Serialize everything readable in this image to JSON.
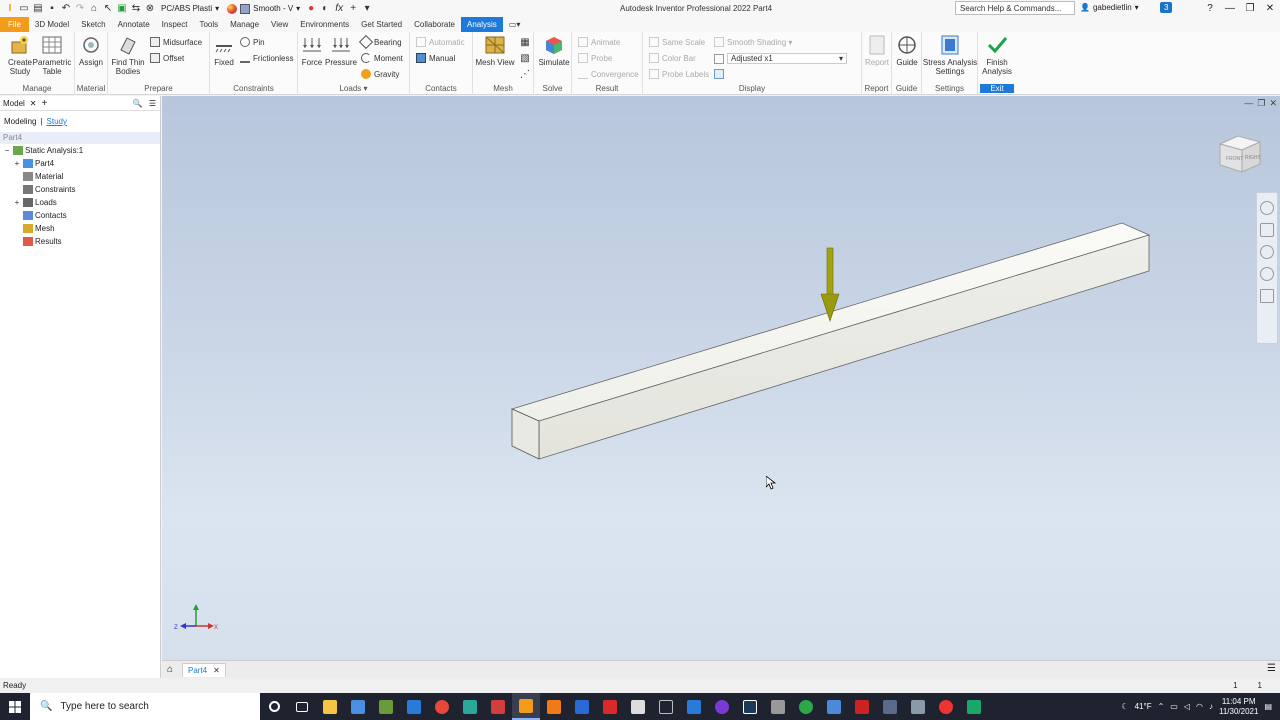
{
  "titlebar": {
    "app_title": "Autodesk Inventor Professional 2022   Part4",
    "material": "PC/ABS Plasti",
    "appearance": "Smooth - V",
    "fx": "fx",
    "search_placeholder": "Search Help & Commands...",
    "user": "gabedietlin",
    "notifications": "3"
  },
  "menu": {
    "tabs": [
      "File",
      "3D Model",
      "Sketch",
      "Annotate",
      "Inspect",
      "Tools",
      "Manage",
      "View",
      "Environments",
      "Get Started",
      "Collaborate",
      "Analysis"
    ],
    "active": "Analysis"
  },
  "ribbon": {
    "panels": {
      "manage": "Manage",
      "material": "Material",
      "prepare": "Prepare",
      "constraints": "Constraints",
      "loads": "Loads ▾",
      "contacts": "Contacts",
      "mesh": "Mesh",
      "solve": "Solve",
      "result": "Result",
      "display": "Display",
      "report": "Report",
      "guide": "Guide",
      "settings": "Settings",
      "exit": "Exit"
    },
    "buttons": {
      "create_study": "Create Study",
      "parametric_table": "Parametric Table",
      "assign": "Assign",
      "find_thin_bodies": "Find Thin Bodies",
      "midsurface": "Midsurface",
      "offset": "Offset",
      "fixed": "Fixed",
      "pin": "Pin",
      "frictionless": "Frictionless",
      "force": "Force",
      "pressure": "Pressure",
      "bearing": "Bearing",
      "moment": "Moment",
      "gravity": "Gravity",
      "automatic": "Automatic",
      "manual": "Manual",
      "mesh_view": "Mesh View",
      "simulate": "Simulate",
      "animate": "Animate",
      "probe": "Probe",
      "convergence": "Convergence",
      "same_scale": "Same Scale",
      "color_bar": "Color Bar",
      "probe_labels": "Probe Labels",
      "smooth_shading": "Smooth Shading ▾",
      "adjusted": "Adjusted x1",
      "report": "Report",
      "guide": "Guide",
      "stress_settings": "Stress Analysis Settings",
      "finish_analysis": "Finish Analysis"
    }
  },
  "browser": {
    "tab": "Model",
    "modes": {
      "modeling": "Modeling",
      "study": "Study"
    },
    "root": "Part4",
    "tree": [
      {
        "label": "Static Analysis:1",
        "level": 0,
        "expand": "−",
        "icon": "analysis-icon"
      },
      {
        "label": "Part4",
        "level": 1,
        "expand": "+",
        "icon": "part-icon"
      },
      {
        "label": "Material",
        "level": 1,
        "expand": "",
        "icon": "material-icon"
      },
      {
        "label": "Constraints",
        "level": 1,
        "expand": "",
        "icon": "constraint-icon"
      },
      {
        "label": "Loads",
        "level": 1,
        "expand": "+",
        "icon": "load-icon"
      },
      {
        "label": "Contacts",
        "level": 1,
        "expand": "",
        "icon": "contact-icon"
      },
      {
        "label": "Mesh",
        "level": 1,
        "expand": "",
        "icon": "mesh-icon"
      },
      {
        "label": "Results",
        "level": 1,
        "expand": "",
        "icon": "results-icon"
      }
    ]
  },
  "doc_tabs": {
    "part": "Part4"
  },
  "status": {
    "text": "Ready",
    "page1": "1",
    "page2": "1"
  },
  "taskbar": {
    "search_placeholder": "Type here to search",
    "weather": "41°F",
    "time": "11:04 PM",
    "date": "11/30/2021"
  },
  "colors": {
    "accent": "#1e7ad8",
    "file_tab": "#f39b1b",
    "load_arrow": "#9a9a10",
    "exit_check": "#1aa34a"
  }
}
